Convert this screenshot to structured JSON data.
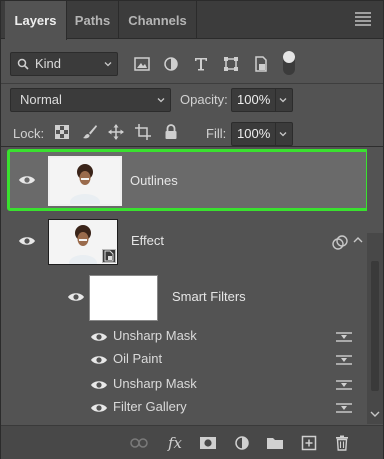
{
  "tabs": [
    {
      "label": "Layers"
    },
    {
      "label": "Paths"
    },
    {
      "label": "Channels"
    }
  ],
  "filter": {
    "kind_label": "Kind"
  },
  "blend": {
    "mode": "Normal",
    "opacity_label": "Opacity:",
    "opacity_value": "100%"
  },
  "lock": {
    "label": "Lock:",
    "fill_label": "Fill:",
    "fill_value": "100%"
  },
  "layers": [
    {
      "name": "Outlines",
      "selected": true
    },
    {
      "name": "Effect",
      "smart_object": true
    }
  ],
  "smart_filters": {
    "label": "Smart Filters",
    "items": [
      {
        "name": "Unsharp Mask"
      },
      {
        "name": "Oil Paint"
      },
      {
        "name": "Unsharp Mask"
      },
      {
        "name": "Filter Gallery"
      }
    ]
  },
  "colors": {
    "selection_highlight": "#39e12f",
    "panel_bg": "#535353",
    "tab_bar": "#3c3c3c"
  }
}
